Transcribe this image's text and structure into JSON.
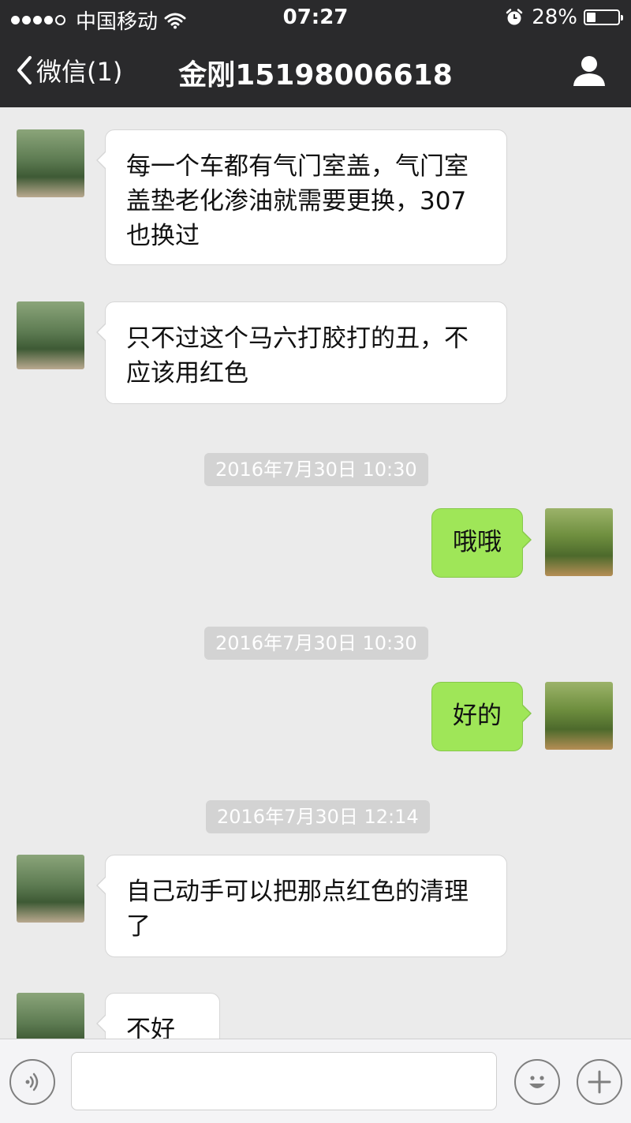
{
  "status_bar": {
    "carrier": "中国移动",
    "time": "07:27",
    "battery_percent_text": "28%",
    "battery_level": 0.28,
    "signal_bars": 4,
    "icons": [
      "signal-dots-icon",
      "wifi-icon",
      "alarm-clock-icon",
      "battery-icon"
    ]
  },
  "nav": {
    "back_label": "微信(1)",
    "title": "金刚15198006618",
    "back_icon": "chevron-left-icon",
    "profile_icon": "person-icon"
  },
  "messages": [
    {
      "side": "in",
      "text": "每一个车都有气门室盖，气门室盖垫老化渗油就需要更换，307也换过"
    },
    {
      "side": "in",
      "text": "只不过这个马六打胶打的丑，不应该用红色"
    },
    {
      "type": "timestamp",
      "text": "2016年7月30日 10:30"
    },
    {
      "side": "out",
      "text": "哦哦"
    },
    {
      "type": "timestamp",
      "text": "2016年7月30日 10:30"
    },
    {
      "side": "out",
      "text": "好的"
    },
    {
      "type": "timestamp",
      "text": "2016年7月30日 12:14"
    },
    {
      "side": "in",
      "text": "自己动手可以把那点红色的清理了"
    },
    {
      "side": "in",
      "text": "不好看"
    }
  ],
  "input_bar": {
    "voice_icon": "voice-icon",
    "emoji_icon": "emoji-smile-icon",
    "plus_icon": "plus-icon",
    "text_value": ""
  },
  "colors": {
    "header_bg": "#2a2a2c",
    "chat_bg": "#ebebeb",
    "incoming_bubble": "#ffffff",
    "outgoing_bubble": "#9fe658",
    "timestamp_bg": "#d3d3d3"
  }
}
